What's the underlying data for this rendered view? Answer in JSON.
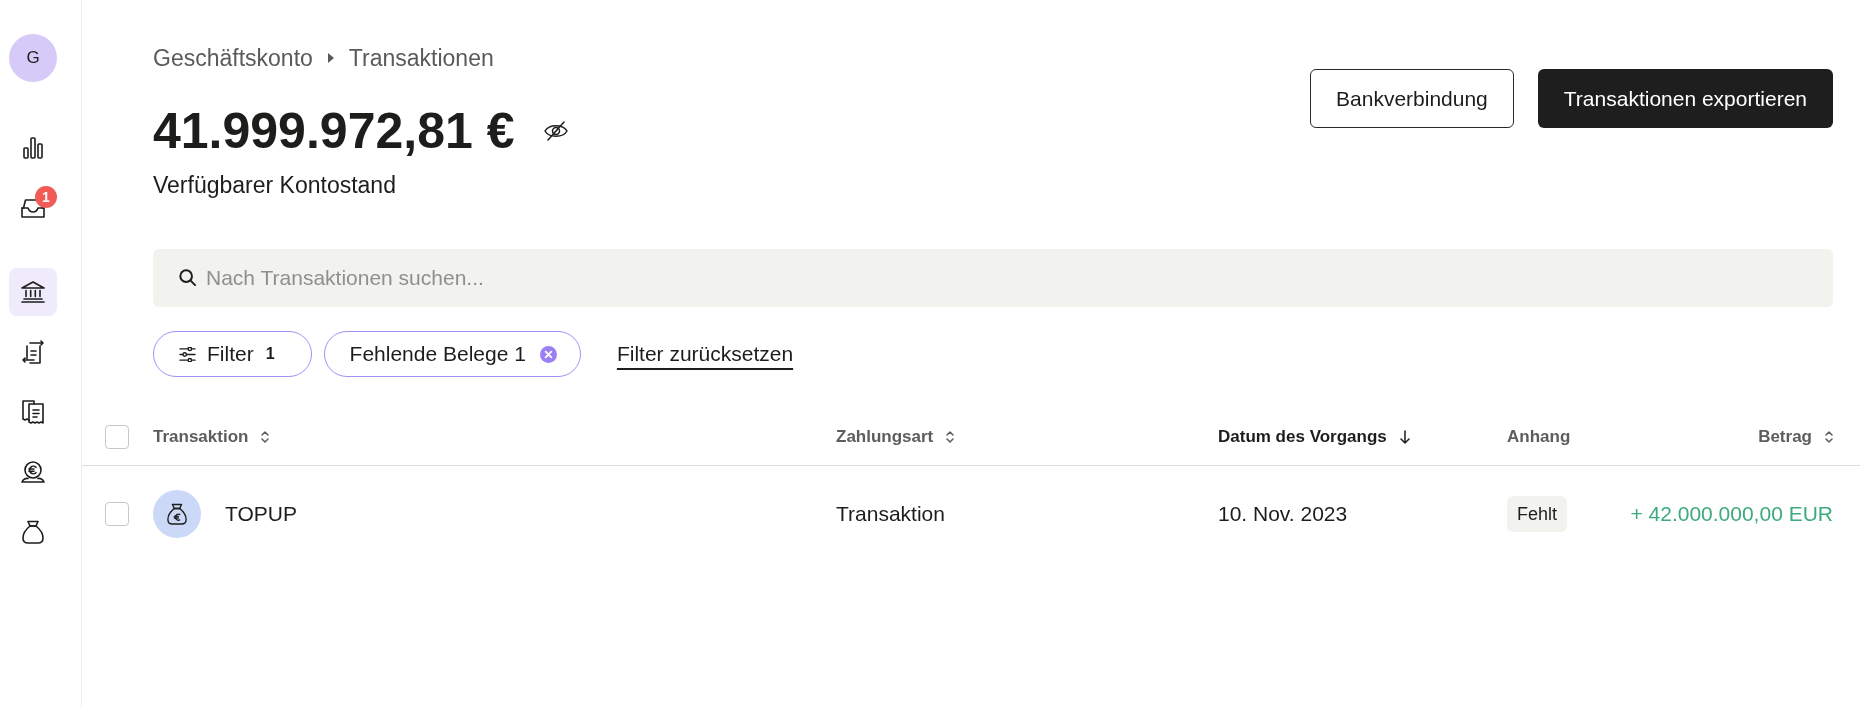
{
  "sidebar": {
    "avatar": "G",
    "groups": [
      {
        "items": [
          {
            "selected": false
          },
          {
            "selected": false,
            "badge": "1"
          }
        ]
      },
      {
        "items": [
          {
            "selected": true
          },
          {
            "selected": false
          },
          {
            "selected": false
          },
          {
            "selected": false
          },
          {
            "selected": false
          }
        ]
      }
    ]
  },
  "breadcrumb": [
    "Geschäftskonto",
    "Transaktionen"
  ],
  "balance": {
    "amount": "41.999.972,81 €",
    "label": "Verfügbarer Kontostand"
  },
  "actions": [
    {
      "label": "Bankverbindung",
      "kind": "outline"
    },
    {
      "label": "Transaktionen exportieren",
      "kind": "primary"
    }
  ],
  "search": {
    "placeholder": "Nach Transaktionen suchen..."
  },
  "filters": {
    "chips": [
      {
        "kind": "menu",
        "label": "Filter",
        "count": "1"
      },
      {
        "kind": "removable",
        "label": "Fehlende Belege 1"
      }
    ],
    "reset": "Filter zurücksetzen"
  },
  "table": {
    "select_all": {
      "checked": false
    },
    "columns": [
      {
        "label": "Transaktion",
        "sortable": true,
        "selected": false
      },
      {
        "label": "Zahlungsart",
        "sortable": true,
        "selected": false
      },
      {
        "label": "Datum des Vorgangs",
        "sortable": true,
        "selected": true
      },
      {
        "label": "Anhang",
        "sortable": false,
        "selected": false
      },
      {
        "label": "Betrag",
        "sortable": true,
        "selected": false
      }
    ],
    "rows": [
      {
        "checked": false,
        "name": "TOPUP",
        "payment_type": "Transaktion",
        "date": "10. Nov. 2023",
        "attachment": "Fehlt",
        "amount": "+ 42.000.000,00 EUR"
      }
    ]
  }
}
